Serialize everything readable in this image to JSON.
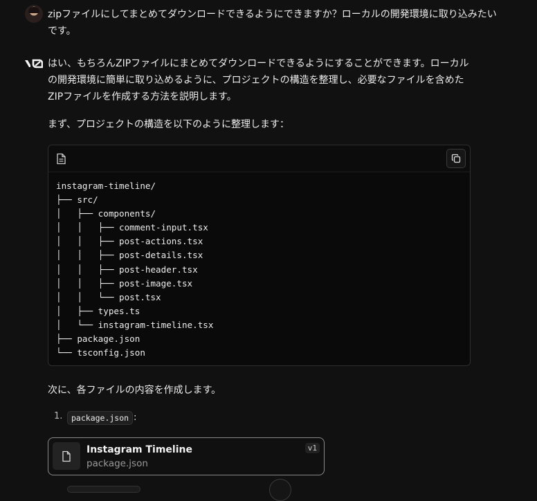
{
  "user_message": {
    "text": "zipファイルにしてまとめてダウンロードできるようにできますか？ローカルの開発環境に取り込みたいです。"
  },
  "assistant": {
    "logo_label": "v0",
    "intro": "はい、もちろんZIPファイルにまとめてダウンロードできるようにすることができます。ローカルの開発環境に簡単に取り込めるように、プロジェクトの構造を整理し、必要なファイルを含めたZIPファイルを作成する方法を説明します。",
    "structure_intro": "まず、プロジェクトの構造を以下のように整理します：",
    "code_block": {
      "lines": [
        "instagram-timeline/",
        "├── src/",
        "│   ├── components/",
        "│   │   ├── comment-input.tsx",
        "│   │   ├── post-actions.tsx",
        "│   │   ├── post-details.tsx",
        "│   │   ├── post-header.tsx",
        "│   │   ├── post-image.tsx",
        "│   │   └── post.tsx",
        "│   ├── types.ts",
        "│   └── instagram-timeline.tsx",
        "├── package.json",
        "└── tsconfig.json"
      ]
    },
    "next_text": "次に、各ファイルの内容を作成します。",
    "list": {
      "number": "1.",
      "code": "package.json",
      "suffix": ":"
    },
    "file_card": {
      "title": "Instagram Timeline",
      "subtitle": "package.json",
      "version": "v1"
    }
  }
}
